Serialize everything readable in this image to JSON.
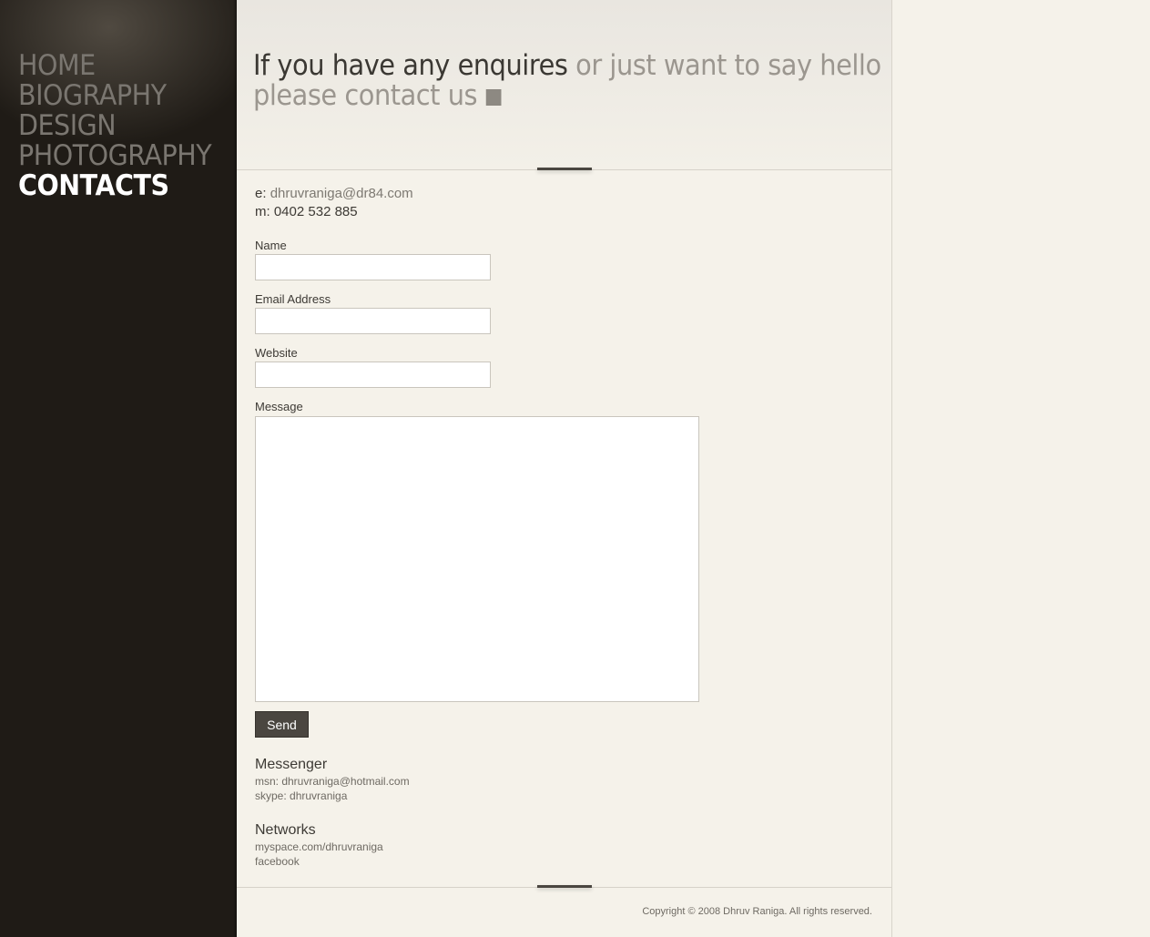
{
  "nav": {
    "items": [
      {
        "label": "HOME"
      },
      {
        "label": "BIOGRAPHY"
      },
      {
        "label": "DESIGN"
      },
      {
        "label": "PHOTOGRAPHY"
      },
      {
        "label": "CONTACTS"
      }
    ],
    "active": "CONTACTS"
  },
  "header": {
    "title_dark": "If you have any enquires",
    "title_light_1": "or just want to say hello",
    "title_light_2": "please contact us"
  },
  "contact": {
    "email_prefix": "e:",
    "email": "dhruvraniga@dr84.com",
    "mobile_prefix": "m:",
    "mobile": "0402 532 885"
  },
  "form": {
    "name_label": "Name",
    "name_value": "",
    "email_label": "Email Address",
    "email_value": "",
    "website_label": "Website",
    "website_value": "",
    "message_label": "Message",
    "message_value": "",
    "send_label": "Send"
  },
  "messenger": {
    "heading": "Messenger",
    "msn": "msn: dhruvraniga@hotmail.com",
    "skype": "skype: dhruvraniga"
  },
  "networks": {
    "heading": "Networks",
    "myspace": "myspace.com/dhruvraniga",
    "facebook": "facebook"
  },
  "footer": {
    "copyright": "Copyright © 2008 Dhruv Raniga. All rights reserved."
  },
  "colors": {
    "sidebar_bg": "#1f1b16",
    "page_bg": "#f5f2ea",
    "nav_inactive": "#7a7670",
    "nav_active": "#ffffff",
    "button_bg": "#4a4640"
  }
}
